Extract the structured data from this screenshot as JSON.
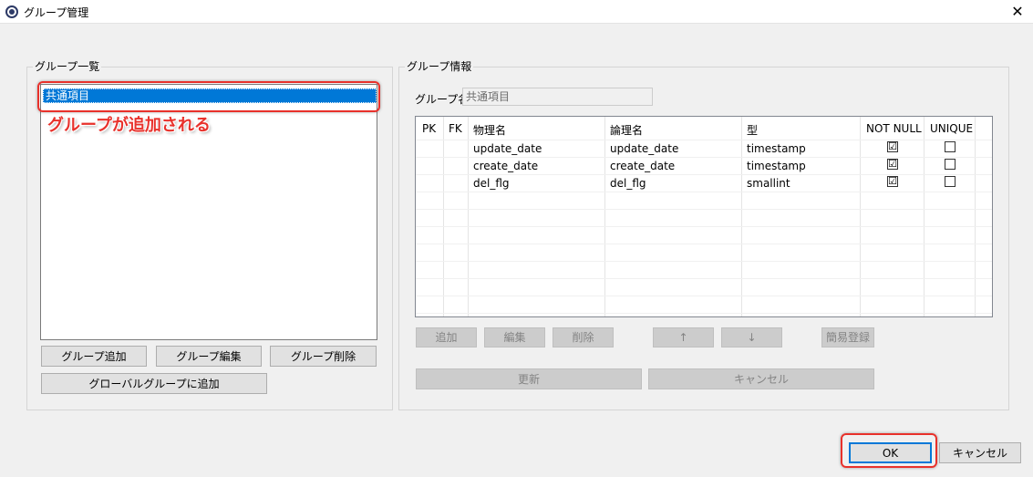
{
  "window": {
    "title": "グループ管理",
    "close_label": "✕"
  },
  "group_list": {
    "legend": "グループ一覧",
    "items": [
      {
        "label": "共通項目",
        "selected": true
      }
    ],
    "annotation": "グループが追加される",
    "buttons": {
      "add": "グループ追加",
      "edit": "グループ編集",
      "delete": "グループ削除",
      "add_global": "グローバルグループに追加"
    }
  },
  "group_info": {
    "legend": "グループ情報",
    "name_label": "グループ名",
    "name_value": "共通項目",
    "table": {
      "headers": {
        "pk": "PK",
        "fk": "FK",
        "physical": "物理名",
        "logical": "論理名",
        "type": "型",
        "not_null": "NOT NULL",
        "unique": "UNIQUE"
      },
      "rows": [
        {
          "pk": "",
          "fk": "",
          "physical": "update_date",
          "logical": "update_date",
          "type": "timestamp",
          "not_null": "☑",
          "unique": ""
        },
        {
          "pk": "",
          "fk": "",
          "physical": "create_date",
          "logical": "create_date",
          "type": "timestamp",
          "not_null": "☑",
          "unique": ""
        },
        {
          "pk": "",
          "fk": "",
          "physical": "del_flg",
          "logical": "del_flg",
          "type": "smallint",
          "not_null": "☑",
          "unique": ""
        }
      ]
    },
    "buttons": {
      "add": "追加",
      "edit": "編集",
      "delete": "削除",
      "up": "↑",
      "down": "↓",
      "quick_register": "簡易登録",
      "update": "更新",
      "cancel": "キャンセル"
    }
  },
  "footer": {
    "ok": "OK",
    "cancel": "キャンセル"
  },
  "colors": {
    "selection": "#0078d7",
    "annotation": "#e8312b",
    "disabled_button": "#cccccc"
  },
  "icons": {
    "app": "app-logo-icon",
    "close": "close-icon",
    "check": "checkbox-checked-icon"
  }
}
